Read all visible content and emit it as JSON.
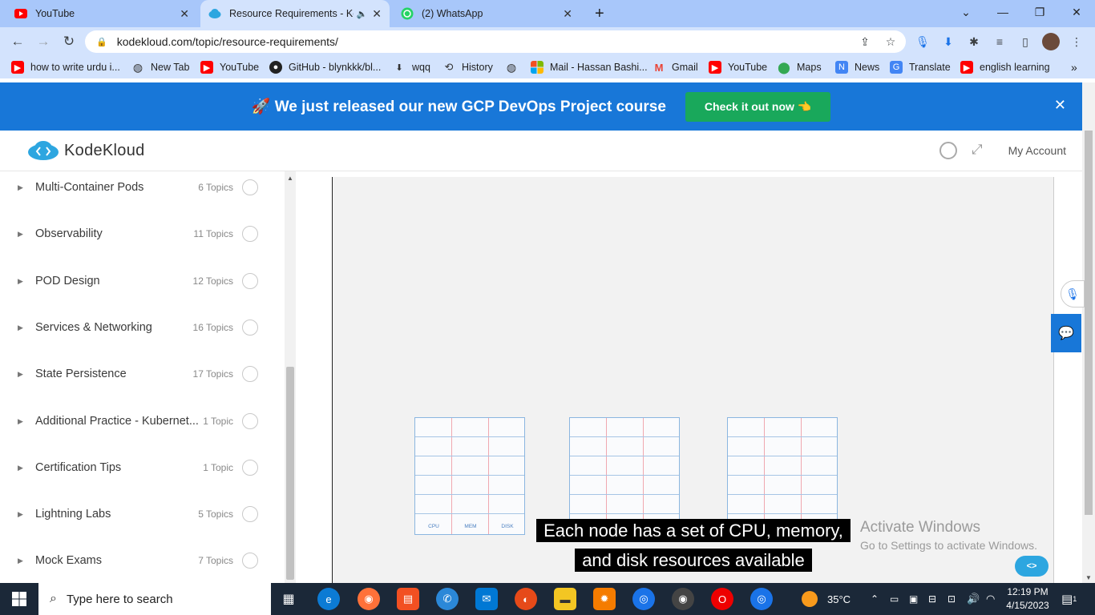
{
  "browser": {
    "tabs": [
      {
        "title": "YouTube",
        "icon": "youtube-icon",
        "active": false
      },
      {
        "title": "Resource Requirements - Ko",
        "icon": "kodekloud-icon",
        "active": true
      },
      {
        "title": "(2) WhatsApp",
        "icon": "whatsapp-icon",
        "active": false
      }
    ],
    "new_tab": "+",
    "url": "kodekloud.com/topic/resource-requirements/",
    "bookmarks": [
      {
        "label": "how to write urdu i...",
        "icon": "youtube-icon"
      },
      {
        "label": "New Tab",
        "icon": "globe-icon"
      },
      {
        "label": "YouTube",
        "icon": "youtube-icon"
      },
      {
        "label": "GitHub - blynkkk/bl...",
        "icon": "github-icon"
      },
      {
        "label": "wqq",
        "icon": "download-icon"
      },
      {
        "label": "History",
        "icon": "history-icon"
      },
      {
        "label": "",
        "icon": "globe-icon"
      },
      {
        "label": "Mail - Hassan Bashi...",
        "icon": "microsoft-icon"
      },
      {
        "label": "Gmail",
        "icon": "gmail-icon"
      },
      {
        "label": "YouTube",
        "icon": "youtube-icon"
      },
      {
        "label": "Maps",
        "icon": "maps-icon"
      },
      {
        "label": "News",
        "icon": "news-icon"
      },
      {
        "label": "Translate",
        "icon": "translate-icon"
      },
      {
        "label": "english learning",
        "icon": "youtube-icon"
      }
    ]
  },
  "banner": {
    "text": "🚀 We just released our new GCP DevOps Project course",
    "button": "Check it out now 👈"
  },
  "header": {
    "logo": "KodeKloud",
    "account": "My Account"
  },
  "sidebar": {
    "modules": [
      {
        "name": "Multi-Container Pods",
        "count": "6 Topics"
      },
      {
        "name": "Observability",
        "count": "11 Topics"
      },
      {
        "name": "POD Design",
        "count": "12 Topics"
      },
      {
        "name": "Services & Networking",
        "count": "16 Topics"
      },
      {
        "name": "State Persistence",
        "count": "17 Topics"
      },
      {
        "name": "Additional Practice - Kubernet...",
        "count": "1 Topic"
      },
      {
        "name": "Certification Tips",
        "count": "1 Topic"
      },
      {
        "name": "Lightning Labs",
        "count": "5 Topics"
      },
      {
        "name": "Mock Exams",
        "count": "7 Topics"
      }
    ]
  },
  "video": {
    "resource_labels": [
      "CPU",
      "MEM",
      "DISK"
    ],
    "caption_line1": "Each node has a set of CPU, memory,",
    "caption_line2": "and disk resources available"
  },
  "watermark": {
    "line1": "Activate Windows",
    "line2": "Go to Settings to activate Windows."
  },
  "taskbar": {
    "search_placeholder": "Type here to search",
    "weather": "35°C",
    "time": "12:19 PM",
    "date": "4/15/2023",
    "notification_count": "1"
  },
  "colors": {
    "banner": "#1877d8",
    "banner_button": "#19a85b",
    "tab_strip": "#a8c7fa",
    "toolbar": "#d3e3fd",
    "taskbar": "#1b2838"
  }
}
